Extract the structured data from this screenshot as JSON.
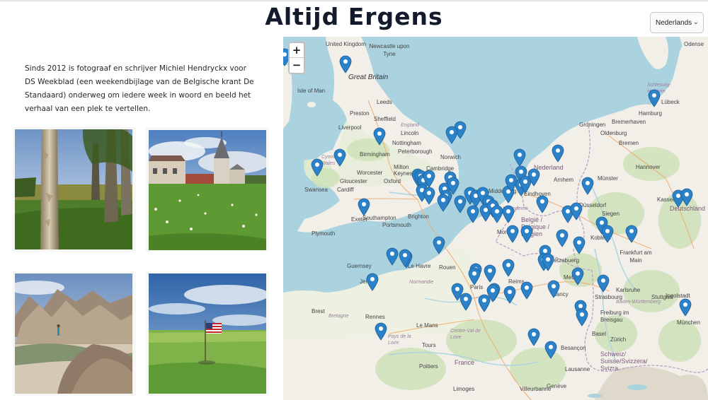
{
  "header": {
    "title": "Altijd Ergens",
    "language": "Nederlands"
  },
  "intro": {
    "text": "Sinds 2012 is fotograaf en schrijver Michiel Hendryckx voor DS Weekblad (een weekendbijlage van de Belgische krant De Standaard) onderweg om iedere week in woord en beeld het verhaal van een plek te vertellen."
  },
  "photos": [
    {
      "name": "photo-tree-avenue",
      "subject": "plane tree trunks in a field"
    },
    {
      "name": "photo-village-church",
      "subject": "church and houses beyond a meadow"
    },
    {
      "name": "photo-badlands",
      "subject": "eroded badlands with a person"
    },
    {
      "name": "photo-prairie-flag",
      "subject": "american flag on a prairie"
    }
  ],
  "map": {
    "zoom_in_label": "+",
    "zoom_out_label": "−",
    "marker_color": "#2c82c9",
    "labels": {
      "united_kingdom": "United Kingdom",
      "newcastle": "Newcastle upon Tyne",
      "great_britain": "Great Britain",
      "isle_of_man": "Isle of Man",
      "leeds": "Leeds",
      "preston": "Preston",
      "liverpool": "Liverpool",
      "sheffield": "Sheffield",
      "lincoln": "Lincoln",
      "nottingham": "Nottingham",
      "peterborough": "Peterborough",
      "england": "England",
      "norwich": "Norwich",
      "birmingham": "Birmingham",
      "cymru": "Cymru / Wales",
      "worcester": "Worcester",
      "milton_keynes": "Milton Keynes",
      "cambridge": "Cambridge",
      "gloucester": "Gloucester",
      "oxford": "Oxford",
      "swansea": "Swansea",
      "cardiff": "Cardiff",
      "exeter": "Exeter",
      "southampton": "Southampton",
      "portsmouth": "Portsmouth",
      "brighton": "Brighton",
      "plymouth": "Plymouth",
      "guernsey": "Guernsey",
      "jersey": "Jersey",
      "le_havre": "Le Havre",
      "rouen": "Rouen",
      "normandie": "Normandie",
      "paris": "Paris",
      "reims": "Reims",
      "brest": "Brest",
      "bretagne": "Bretagne",
      "rennes": "Rennes",
      "le_mans": "Le Mans",
      "pays_de_la_loire": "Pays de la Loire",
      "centre_val_de_loire": "Centre-Val de Loire",
      "tours": "Tours",
      "france": "France",
      "poitiers": "Poitiers",
      "limoges": "Limoges",
      "villeurbanne": "Villeurbanne",
      "nederland": "Nederland",
      "groningen": "Groningen",
      "arnhem": "Arnhem",
      "middelburg": "Middelburg",
      "eindhoven": "Eindhoven",
      "vlaanderen": "Vlaanderen",
      "belgie": "België / Belgique / Belgien",
      "mons": "Mons",
      "luxembourg": "Lëtzebuerg",
      "metz": "Metz",
      "nancy": "Nancy",
      "strasbourg": "Strasbourg",
      "besancon": "Besançon",
      "lausanne": "Lausanne",
      "geneve": "Genève",
      "hamburg": "Hamburg",
      "bremerhaven": "Bremerhaven",
      "oldenburg": "Oldenburg",
      "bremen": "Bremen",
      "hannover": "Hannover",
      "munster": "Münster",
      "dusseldorf": "Düsseldorf",
      "kassel": "Kassel",
      "siegen": "Siegen",
      "frankfurt": "Frankfurt am Main",
      "deutschland": "Deutschland",
      "koblenz": "Koblenz",
      "karlsruhe": "Karlsruhe",
      "stuttgart": "Stuttgart",
      "baden_wurttemberg": "Baden-Württemberg",
      "freiburg": "Freiburg im Breisgau",
      "basel": "Basel",
      "zurich": "Zürich",
      "schweiz": "Schweiz/ Suisse/Svizzera/ Svizra",
      "munchen": "München",
      "lubeck": "Lübeck",
      "odense": "Odense",
      "schleswig": "Schleswig-Holstein",
      "ingolstadt": "Ingolstadt"
    }
  }
}
